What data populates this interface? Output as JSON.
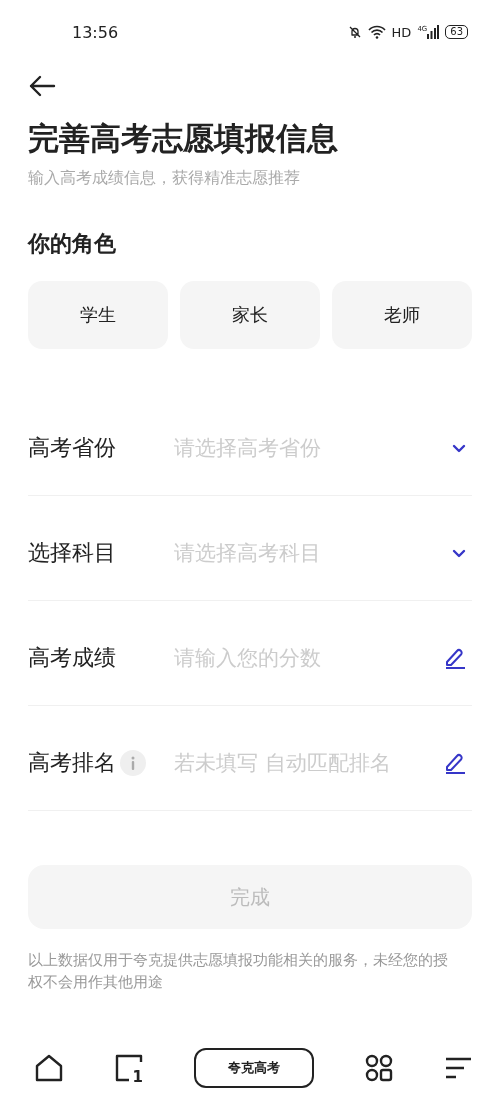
{
  "status_bar": {
    "time": "13:56",
    "network": "HD",
    "cellular": "4G",
    "battery": "63"
  },
  "title": "完善高考志愿填报信息",
  "subtitle": "输入高考成绩信息，获得精准志愿推荐",
  "role_section": {
    "label": "你的角色",
    "options": [
      {
        "label": "学生",
        "selected": false
      },
      {
        "label": "家长",
        "selected": false
      },
      {
        "label": "老师",
        "selected": false
      }
    ]
  },
  "fields": [
    {
      "label": "高考省份",
      "placeholder": "请选择高考省份",
      "kind": "select",
      "info": false
    },
    {
      "label": "选择科目",
      "placeholder": "请选择高考科目",
      "kind": "select",
      "info": false
    },
    {
      "label": "高考成绩",
      "placeholder": "请输入您的分数",
      "kind": "input",
      "info": false
    },
    {
      "label": "高考排名",
      "placeholder": "若未填写 自动匹配排名",
      "kind": "input",
      "info": true
    }
  ],
  "submit": {
    "label": "完成",
    "disabled": true
  },
  "notice": "以上数据仅用于夸克提供志愿填报功能相关的服务，未经您的授权不会用作其他用途",
  "bottom_nav": {
    "tab_count": "1",
    "center_label": "夸克高考"
  }
}
